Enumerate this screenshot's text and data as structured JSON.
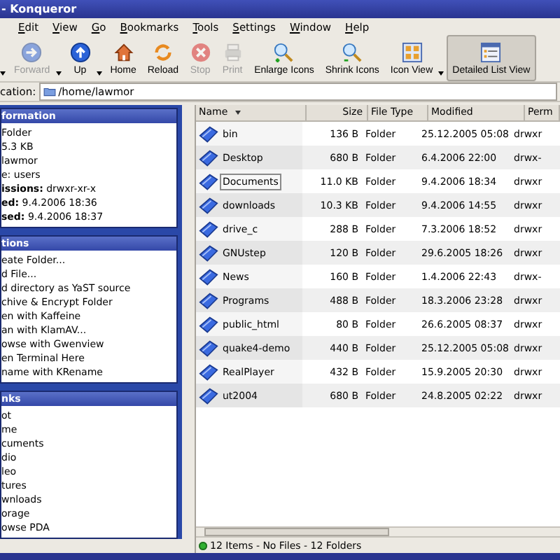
{
  "window": {
    "title": "- Konqueror"
  },
  "menu": [
    "Edit",
    "View",
    "Go",
    "Bookmarks",
    "Tools",
    "Settings",
    "Window",
    "Help"
  ],
  "toolbar": [
    {
      "kind": "caret-only",
      "has_menu": true
    },
    {
      "kind": "button",
      "label": "Forward",
      "has_menu": true,
      "disabled": true,
      "selected": false
    },
    {
      "kind": "button",
      "label": "Up",
      "has_menu": true,
      "disabled": false,
      "selected": false
    },
    {
      "kind": "button",
      "label": "Home",
      "has_menu": false,
      "disabled": false,
      "selected": false
    },
    {
      "kind": "button",
      "label": "Reload",
      "has_menu": false,
      "disabled": false,
      "selected": false
    },
    {
      "kind": "button",
      "label": "Stop",
      "has_menu": false,
      "disabled": true,
      "selected": false
    },
    {
      "kind": "button",
      "label": "Print",
      "has_menu": false,
      "disabled": true,
      "selected": false
    },
    {
      "kind": "button",
      "label": "Enlarge Icons",
      "has_menu": false,
      "disabled": false,
      "selected": false
    },
    {
      "kind": "button",
      "label": "Shrink Icons",
      "has_menu": false,
      "disabled": false,
      "selected": false
    },
    {
      "kind": "button",
      "label": "Icon View",
      "has_menu": true,
      "disabled": false,
      "selected": false
    },
    {
      "kind": "button",
      "label": "Detailed List View",
      "has_menu": false,
      "disabled": false,
      "selected": true
    }
  ],
  "location": {
    "label": "cation:",
    "value": "/home/lawmor"
  },
  "sidebar": [
    {
      "title": "formation",
      "items": [
        "Folder",
        "5.3 KB",
        "lawmor",
        "e: users",
        "**issions:** drwxr-xr-x",
        "**ed:** 9.4.2006 18:36",
        "**sed:** 9.4.2006 18:37"
      ]
    },
    {
      "title": "tions",
      "items": [
        "eate Folder...",
        "d File...",
        "d directory as YaST source",
        "chive & Encrypt Folder",
        "en with Kaffeine",
        "an with KlamAV...",
        "owse with Gwenview",
        "en Terminal Here",
        "name with KRename"
      ]
    },
    {
      "title": "nks",
      "items": [
        "ot",
        "me",
        "cuments",
        "dio",
        "leo",
        "tures",
        "wnloads",
        "orage",
        "owse PDA"
      ]
    }
  ],
  "table": {
    "columns": [
      "Name",
      "Size",
      "File Type",
      "Modified",
      "Perm"
    ],
    "rows": [
      {
        "cells": [
          "bin",
          "136 B",
          "Folder",
          "25.12.2005 05:08",
          "drwxr"
        ],
        "selected": false
      },
      {
        "cells": [
          "Desktop",
          "680 B",
          "Folder",
          "6.4.2006 22:00",
          "drwx-"
        ],
        "selected": false
      },
      {
        "cells": [
          "Documents",
          "11.0 KB",
          "Folder",
          "9.4.2006 18:34",
          "drwxr"
        ],
        "selected": true
      },
      {
        "cells": [
          "downloads",
          "10.3 KB",
          "Folder",
          "9.4.2006 14:55",
          "drwxr"
        ],
        "selected": false
      },
      {
        "cells": [
          "drive_c",
          "288 B",
          "Folder",
          "7.3.2006 18:52",
          "drwxr"
        ],
        "selected": false
      },
      {
        "cells": [
          "GNUstep",
          "120 B",
          "Folder",
          "29.6.2005 18:26",
          "drwxr"
        ],
        "selected": false
      },
      {
        "cells": [
          "News",
          "160 B",
          "Folder",
          "1.4.2006 22:43",
          "drwx-"
        ],
        "selected": false
      },
      {
        "cells": [
          "Programs",
          "488 B",
          "Folder",
          "18.3.2006 23:28",
          "drwxr"
        ],
        "selected": false
      },
      {
        "cells": [
          "public_html",
          "80 B",
          "Folder",
          "26.6.2005 08:37",
          "drwxr"
        ],
        "selected": false
      },
      {
        "cells": [
          "quake4-demo",
          "440 B",
          "Folder",
          "25.12.2005 05:08",
          "drwxr"
        ],
        "selected": false
      },
      {
        "cells": [
          "RealPlayer",
          "432 B",
          "Folder",
          "15.9.2005 20:30",
          "drwxr"
        ],
        "selected": false
      },
      {
        "cells": [
          "ut2004",
          "680 B",
          "Folder",
          "24.8.2005 02:22",
          "drwxr"
        ],
        "selected": false
      }
    ]
  },
  "status_bar": "12 Items - No Files - 12 Folders"
}
